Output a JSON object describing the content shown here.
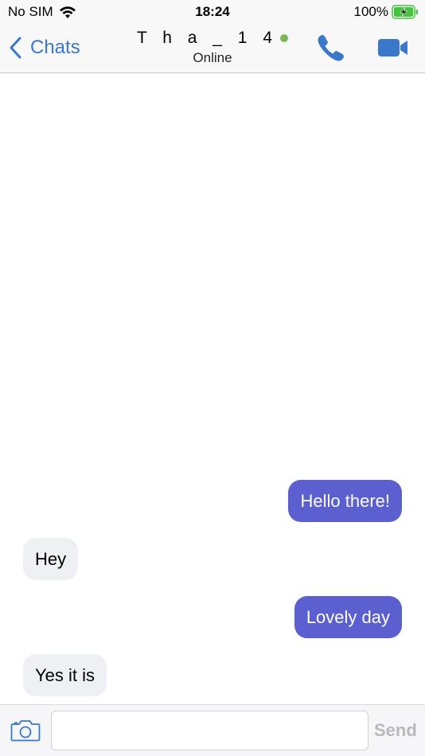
{
  "status_bar": {
    "carrier": "No SIM",
    "time": "18:24",
    "battery_percent": "100%",
    "wifi_icon": "wifi-icon",
    "battery_icon": "battery-charging-icon",
    "battery_level": 1.0,
    "battery_color": "#45c43e"
  },
  "nav": {
    "back_label": "Chats",
    "title": "T h a _ 1 4",
    "subtitle": "Online",
    "status_color": "#7cb657",
    "accent": "#3a78c9",
    "call_icon": "phone-icon",
    "video_icon": "video-camera-icon"
  },
  "messages": [
    {
      "text": "Hello there!",
      "direction": "outgoing"
    },
    {
      "text": "Hey",
      "direction": "incoming"
    },
    {
      "text": "Lovely day",
      "direction": "outgoing"
    },
    {
      "text": "Yes it is",
      "direction": "incoming"
    }
  ],
  "composer": {
    "value": "",
    "placeholder": "",
    "send_label": "Send",
    "camera_icon": "camera-icon"
  },
  "colors": {
    "outgoing_bubble": "#5b5fcf",
    "incoming_bubble": "#eef0f3"
  }
}
